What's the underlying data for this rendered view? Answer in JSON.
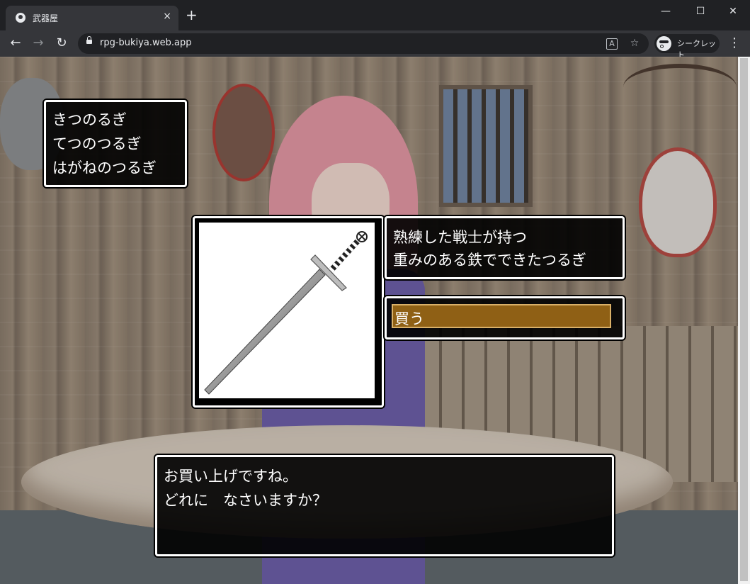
{
  "browser": {
    "tab_title": "武器屋",
    "tab_close": "×",
    "new_tab": "+",
    "url": "rpg-bukiya.web.app",
    "incognito_label": "シークレット",
    "minimize": "—",
    "maximize": "☐",
    "close": "✕",
    "back": "←",
    "forward": "→",
    "reload": "↻",
    "menu": "⋮",
    "translate_icon": "translate-icon",
    "bookmark_icon": "★"
  },
  "game": {
    "item_list": [
      "きつのるぎ",
      "てつのつるぎ",
      "はがねのつるぎ"
    ],
    "description": [
      "熟練した戦士が持つ",
      "重みのある鉄でできたつるぎ"
    ],
    "command": "買う",
    "message": [
      "お買い上げですね。",
      "どれに　なさいますか？"
    ],
    "item_image": "sword-icon",
    "colors": {
      "window_border": "#ffffff",
      "window_bg": "#000000",
      "selected_command": "#8f6015"
    }
  }
}
